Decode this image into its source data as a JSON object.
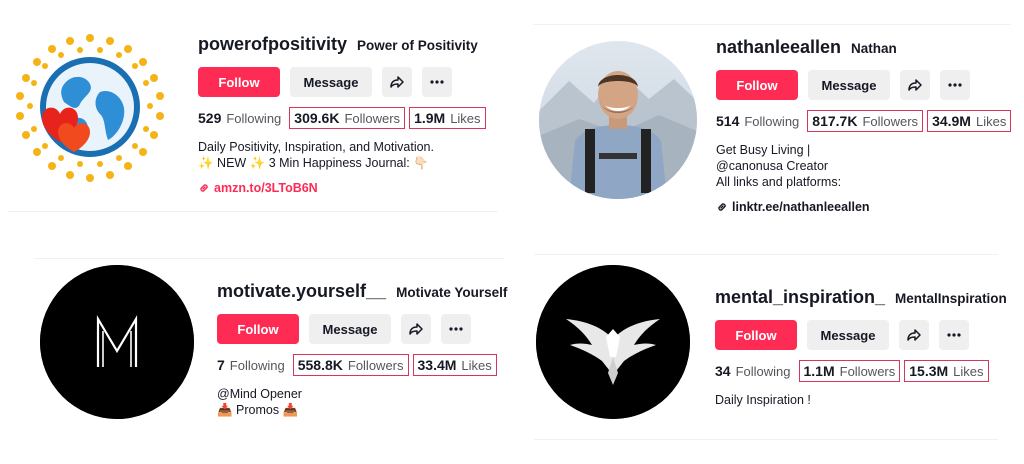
{
  "accent": "#fe2c55",
  "highlight_border": "#d6355c",
  "profiles": [
    {
      "username": "powerofpositivity",
      "nickname": "Power of Positivity",
      "follow_label": "Follow",
      "message_label": "Message",
      "following_count": "529",
      "following_label": "Following",
      "followers_count": "309.6K",
      "followers_label": "Followers",
      "likes_count": "1.9M",
      "likes_label": "Likes",
      "bio": [
        "Daily Positivity, Inspiration, and Motivation.",
        "✨ NEW ✨ 3 Min Happiness Journal: 👇🏻"
      ],
      "link": "amzn.to/3LToB6N",
      "link_color": "#fe2c55",
      "avatar_icon": "globe-hearts-sun-logo"
    },
    {
      "username": "nathanleeallen",
      "nickname": "Nathan",
      "follow_label": "Follow",
      "message_label": "Message",
      "following_count": "514",
      "following_label": "Following",
      "followers_count": "817.7K",
      "followers_label": "Followers",
      "likes_count": "34.9M",
      "likes_label": "Likes",
      "bio": [
        "Get Busy Living |",
        "@canonusa Creator",
        "All links and platforms:"
      ],
      "link": "linktr.ee/nathanleeallen",
      "link_color": "#161823",
      "avatar_icon": "hiker-photo"
    },
    {
      "username": "motivate.yourself__",
      "nickname": "Motivate Yourself",
      "follow_label": "Follow",
      "message_label": "Message",
      "following_count": "7",
      "following_label": "Following",
      "followers_count": "558.8K",
      "followers_label": "Followers",
      "likes_count": "33.4M",
      "likes_label": "Likes",
      "bio": [
        "@Mind Opener",
        "📥 Promos 📥"
      ],
      "avatar_icon": "letter-m-logo"
    },
    {
      "username": "mental_inspiration_",
      "nickname": "MentalInspiration",
      "follow_label": "Follow",
      "message_label": "Message",
      "following_count": "34",
      "following_label": "Following",
      "followers_count": "1.1M",
      "followers_label": "Followers",
      "likes_count": "15.3M",
      "likes_label": "Likes",
      "bio": [
        "Daily Inspiration !"
      ],
      "avatar_icon": "eagle-logo"
    }
  ]
}
